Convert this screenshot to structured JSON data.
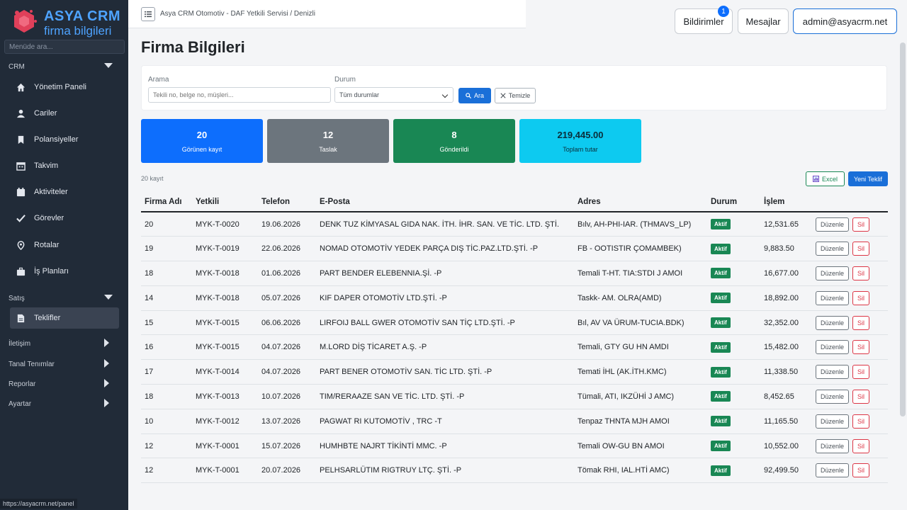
{
  "brand": {
    "title": "ASYA CRM",
    "subtitle": "firma bilgileri"
  },
  "sidebar": {
    "search_placeholder": "Menüde ara...",
    "sections": {
      "crm": "CRM",
      "satis": "Satış"
    },
    "items": [
      {
        "label": "Yönetim Paneli"
      },
      {
        "label": "Cariler"
      },
      {
        "label": "Polansiyeller"
      },
      {
        "label": "Takvim"
      },
      {
        "label": "Aktiviteler"
      },
      {
        "label": "Görevler"
      },
      {
        "label": "Rotalar"
      },
      {
        "label": "İş Planları"
      },
      {
        "label": "Teklifler"
      }
    ],
    "groups": [
      "İletişim",
      "Tanal Tenımlar",
      "Reporlar",
      "Ayartar"
    ],
    "status_url": "https://asyacrm.net/panel"
  },
  "topbar": {
    "breadcrumb": "Asya CRM Otomotiv - DAF Yetkili Servisi / Denizli",
    "notifications_label": "Bildirimler",
    "notifications_count": "1",
    "messages_label": "Mesajlar",
    "user_label": "admin@asyacrm.net"
  },
  "page": {
    "title": "Firma Bilgileri"
  },
  "filters": {
    "search_label": "Arama",
    "search_placeholder": "Tekili no, belge no, müşleri...",
    "status_label": "Durum",
    "status_value": "Tüm durumlar",
    "search_button": "Ara",
    "clear_button": "Temizle"
  },
  "stats": [
    {
      "value": "20",
      "label": "Görünen kayıt",
      "color": "#0d6efd"
    },
    {
      "value": "12",
      "label": "Taslak",
      "color": "#6c757d"
    },
    {
      "value": "8",
      "label": "Gönderildi",
      "color": "#198754"
    },
    {
      "value": "219,445.00",
      "label": "Toplam tutar",
      "color": "#0dcaf0"
    }
  ],
  "list": {
    "count_text": "20 kayıt",
    "excel_button": "Excel",
    "new_button": "Yeni Teklif"
  },
  "table": {
    "headers": [
      "Firma Adı",
      "Yetkili",
      "Telefon",
      "E-Posta",
      "Adres",
      "Durum",
      "İşlem"
    ],
    "rows": [
      {
        "no": "20",
        "code": "MYK-T-0020",
        "date": "19.06.2026",
        "company": "DENK TUZ KİMYASAL GIDA NAK. İTH. İHR. SAN. VE TİC. LTD. ŞTİ.",
        "addr": "Bılv, AH-PHI-IAR. (THMAVS_LP)",
        "status": "Aktif",
        "amount": "12,531.65",
        "edit": "Düzenle",
        "del": "Sil"
      },
      {
        "no": "19",
        "code": "MYK-T-0019",
        "date": "22.06.2026",
        "company": "NOMAD OTOMOTİV YEDEK PARÇA DIŞ TİC.PAZ.LTD.ŞTİ. -P",
        "addr": "FB - OOTISTIR ÇOMAMBEK)",
        "status": "Aktif",
        "amount": "9,883.50",
        "edit": "Düzenle",
        "del": "Sil"
      },
      {
        "no": "18",
        "code": "MYK-T-0018",
        "date": "01.06.2026",
        "company": "PART BENDER ELEBENNIA.Şİ. -P",
        "addr": "Temali T-HT. TIA:STDI J AMOI",
        "status": "Aktif",
        "amount": "16,677.00",
        "edit": "Düzenle",
        "del": "Sil"
      },
      {
        "no": "14",
        "code": "MYK-T-0018",
        "date": "05.07.2026",
        "company": "KIF DAPER OTOMOTİV LTD.ŞTİ. -P",
        "addr": "Taskk- AM. OLRA(AMD)",
        "status": "Aktif",
        "amount": "18,892.00",
        "edit": "Düzenle",
        "del": "Sil"
      },
      {
        "no": "15",
        "code": "MYK-T-0015",
        "date": "06.06.2026",
        "company": "LIRFOIJ BALL GWER OTOMOTİV SAN TİÇ LTD.ŞTİ. -P",
        "addr": "Bıl, AV VA ÜRUM-TUCIA.BDK)",
        "status": "Aktif",
        "amount": "32,352.00",
        "edit": "Düzenle",
        "del": "Sil"
      },
      {
        "no": "16",
        "code": "MYK-T-0015",
        "date": "04.07.2026",
        "company": "M.LORD DİŞ TİCARET A.Ş. -P",
        "addr": "Temali, GTY GU HN AMDI",
        "status": "Aktif",
        "amount": "15,482.00",
        "edit": "Düzenle",
        "del": "Sil"
      },
      {
        "no": "17",
        "code": "MYK-T-0014",
        "date": "04.07.2026",
        "company": "PART BENER OTOMOTİV SAN. TİC LTD. ŞTİ. -P",
        "addr": "Temati İHL (AK.İTH.KMC)",
        "status": "Aktif",
        "amount": "11,338.50",
        "edit": "Düzenle",
        "del": "Sil"
      },
      {
        "no": "18",
        "code": "MYK-T-0013",
        "date": "10.07.2026",
        "company": "TIM/RERAAZE SAN VE TİC. LTD. ŞTİ. -P",
        "addr": "Tümali, ATI, IKZÜHİ J AMC)",
        "status": "Aktif",
        "amount": "8,452.65",
        "edit": "Düzenle",
        "del": "Sil"
      },
      {
        "no": "10",
        "code": "MYK-T-0012",
        "date": "13.07.2026",
        "company": "PAGWAT RI KUTOMOTİV , TRC -T",
        "addr": "Tenpaz THNTA MJH AMOI",
        "status": "Aktif",
        "amount": "11,165.50",
        "edit": "Düzenle",
        "del": "Sil"
      },
      {
        "no": "12",
        "code": "MYK-T-0001",
        "date": "15.07.2026",
        "company": "HUMHBTE NAJRT TİKİNTİ MMC. -P",
        "addr": "Temali OW-GU BN AMOI",
        "status": "Aktif",
        "amount": "10,552.00",
        "edit": "Düzenle",
        "del": "Sil"
      },
      {
        "no": "12",
        "code": "MYK-T-0001",
        "date": "20.07.2026",
        "company": "PELHSARLÜTIM RIGTRUY LTÇ. ŞTİ. -P",
        "addr": "Tömak RHI, IAL.HTİ AMC)",
        "status": "Aktif",
        "amount": "92,499.50",
        "edit": "Düzenle",
        "del": "Sil"
      }
    ]
  }
}
